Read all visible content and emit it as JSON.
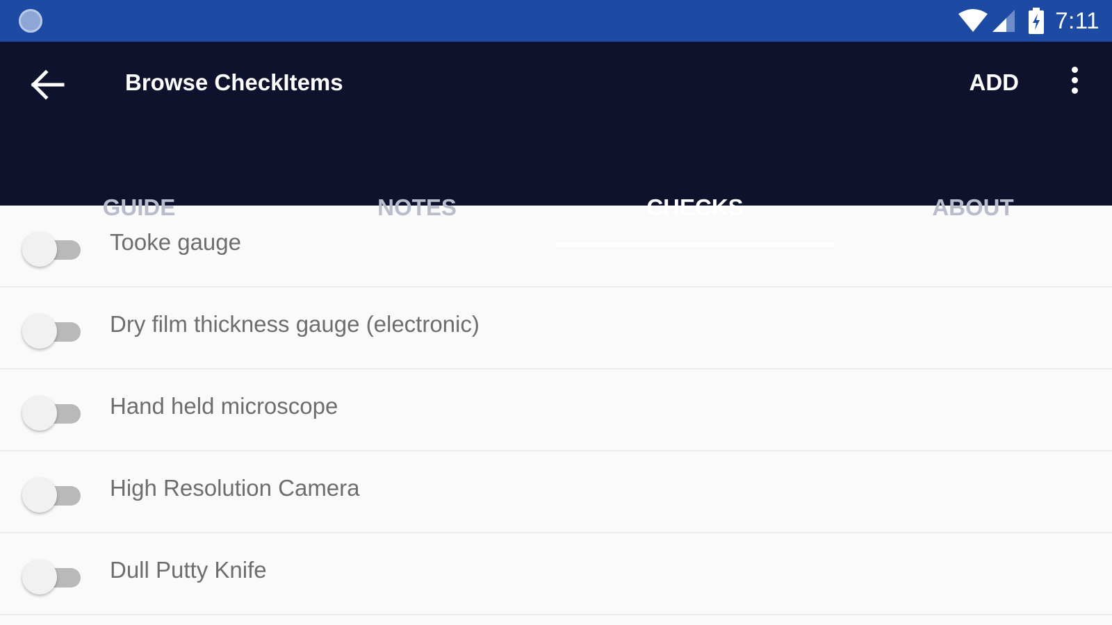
{
  "status_bar": {
    "time": "7:11",
    "icons": [
      "wifi-icon",
      "cell-signal-icon",
      "battery-charging-icon"
    ],
    "color": "#1d4aa3"
  },
  "app_bar": {
    "title": "Browse CheckItems",
    "back_icon": "arrow-left-icon",
    "add_label": "ADD",
    "overflow_icon": "more-vert-icon",
    "color": "#0e122d"
  },
  "tabs": [
    {
      "label": "GUIDE",
      "active": false
    },
    {
      "label": "NOTES",
      "active": false
    },
    {
      "label": "CHECKS",
      "active": true
    },
    {
      "label": "ABOUT",
      "active": false
    }
  ],
  "checks": [
    {
      "label": "Tooke gauge",
      "checked": false
    },
    {
      "label": "Dry film thickness gauge (electronic)",
      "checked": false
    },
    {
      "label": "Hand held microscope",
      "checked": false
    },
    {
      "label": "High Resolution Camera",
      "checked": false
    },
    {
      "label": "Dull Putty Knife",
      "checked": false
    }
  ]
}
